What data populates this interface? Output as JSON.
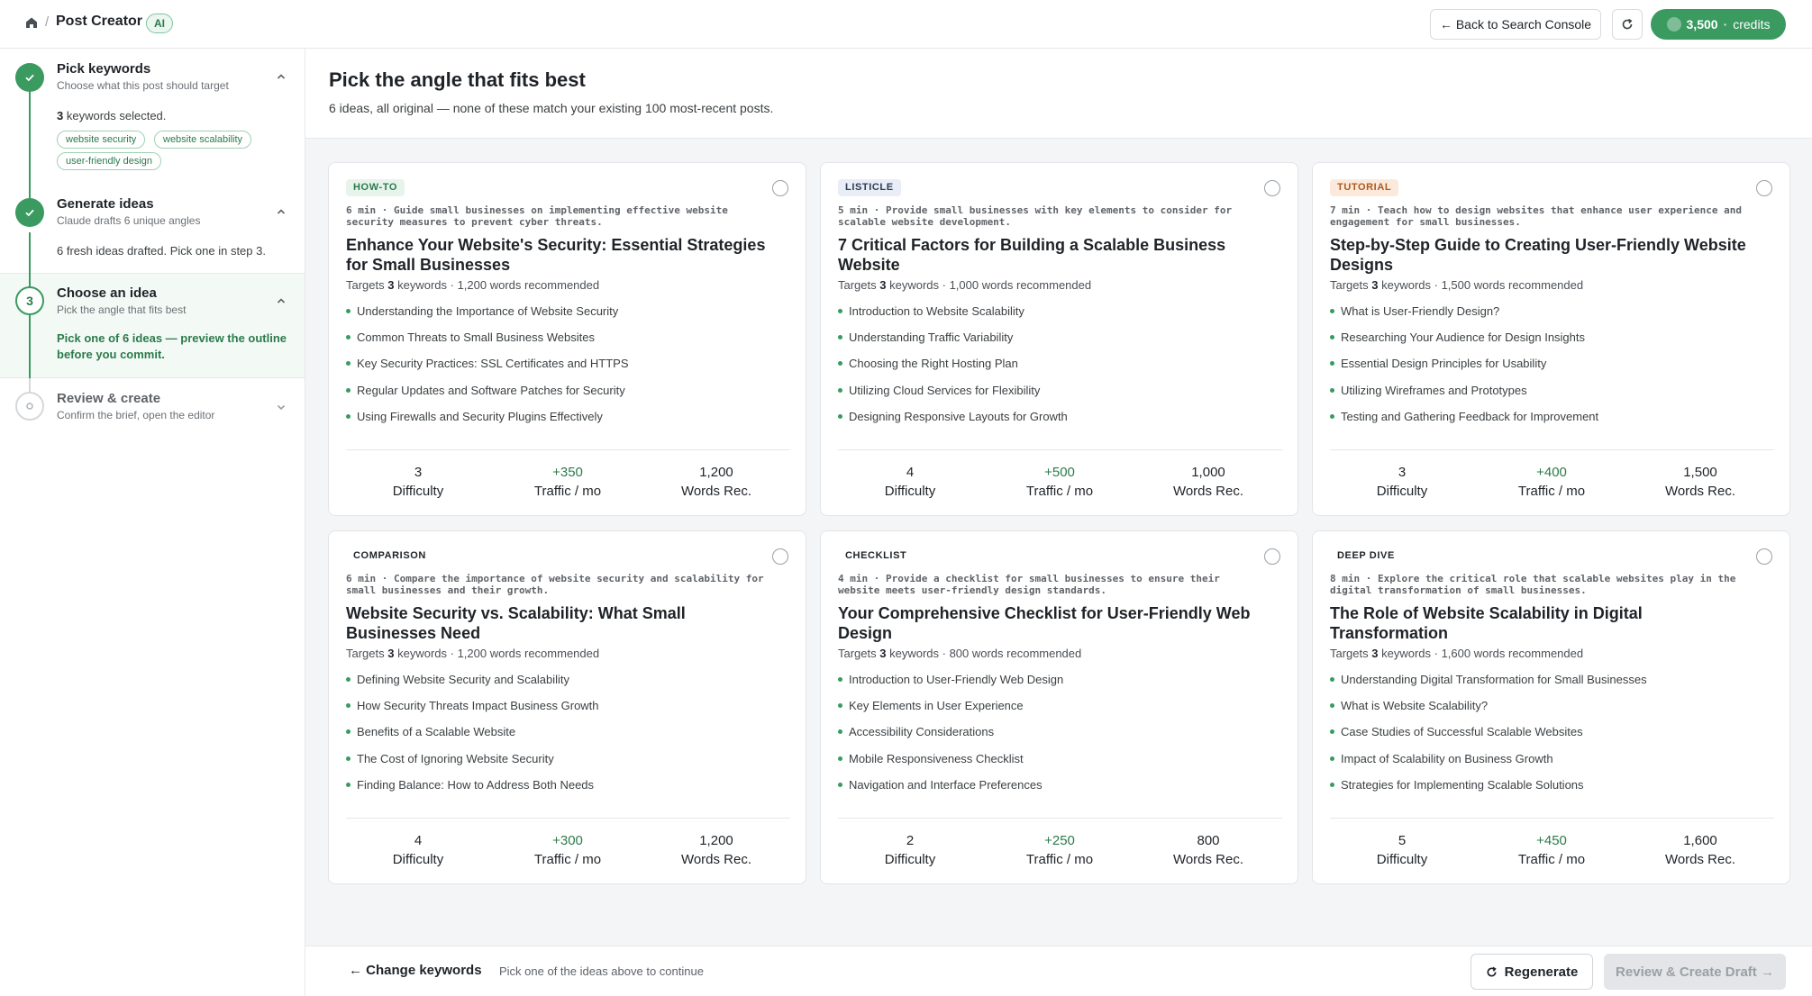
{
  "header": {
    "app_title": "Post Creator",
    "ai_badge": "AI",
    "back_label": "← Back to Search Console",
    "credits_value": "3,500",
    "credits_sep": "·",
    "credits_label": "credits"
  },
  "sidebar": {
    "steps": [
      {
        "title": "Pick keywords",
        "subtitle": "Choose what this post should target",
        "state": "done"
      },
      {
        "title": "Generate ideas",
        "subtitle": "Claude drafts 6 unique angles",
        "state": "done"
      },
      {
        "number": "3",
        "title": "Choose an idea",
        "subtitle": "Pick the angle that fits best",
        "state": "active"
      },
      {
        "title": "Review & create",
        "subtitle": "Confirm the brief, open the editor",
        "state": "pending"
      }
    ],
    "keywords_count": "3",
    "keywords_suffix": " keywords selected.",
    "keyword_chips": [
      "website security",
      "website scalability",
      "user-friendly design"
    ],
    "generate_note": "6 fresh ideas drafted. Pick one in step 3.",
    "choose_note": "Pick one of 6 ideas — preview the outline before you commit."
  },
  "main": {
    "title": "Pick the angle that fits best",
    "subtitle": "6 ideas, all original — none of these match your existing 100 most-recent posts.",
    "targets_prefix": "Targets ",
    "targets_mid": " keywords · ",
    "stat_labels": {
      "difficulty": "Difficulty",
      "traffic": "Traffic / mo",
      "words": "Words Rec."
    },
    "cards": [
      {
        "badge": "HOW-TO",
        "meta": "6 min · Guide small businesses on implementing effective website security measures to prevent cyber threats.",
        "title": "Enhance Your Website's Security: Essential Strategies for Small Businesses",
        "keywords": "3",
        "words_text": "1,200 words recommended",
        "outline": [
          "Understanding the Importance of Website Security",
          "Common Threats to Small Business Websites",
          "Key Security Practices: SSL Certificates and HTTPS",
          "Regular Updates and Software Patches for Security",
          "Using Firewalls and Security Plugins Effectively"
        ],
        "difficulty": "3",
        "traffic": "+350",
        "words": "1,200"
      },
      {
        "badge": "LISTICLE",
        "meta": "5 min · Provide small businesses with key elements to consider for scalable website development.",
        "title": "7 Critical Factors for Building a Scalable Business Website",
        "keywords": "3",
        "words_text": "1,000 words recommended",
        "outline": [
          "Introduction to Website Scalability",
          "Understanding Traffic Variability",
          "Choosing the Right Hosting Plan",
          "Utilizing Cloud Services for Flexibility",
          "Designing Responsive Layouts for Growth"
        ],
        "difficulty": "4",
        "traffic": "+500",
        "words": "1,000"
      },
      {
        "badge": "TUTORIAL",
        "meta": "7 min · Teach how to design websites that enhance user experience and engagement for small businesses.",
        "title": "Step-by-Step Guide to Creating User-Friendly Website Designs",
        "keywords": "3",
        "words_text": "1,500 words recommended",
        "outline": [
          "What is User-Friendly Design?",
          "Researching Your Audience for Design Insights",
          "Essential Design Principles for Usability",
          "Utilizing Wireframes and Prototypes",
          "Testing and Gathering Feedback for Improvement"
        ],
        "difficulty": "3",
        "traffic": "+400",
        "words": "1,500"
      },
      {
        "badge": "COMPARISON",
        "meta": "6 min · Compare the importance of website security and scalability for small businesses and their growth.",
        "title": "Website Security vs. Scalability: What Small Businesses Need",
        "keywords": "3",
        "words_text": "1,200 words recommended",
        "outline": [
          "Defining Website Security and Scalability",
          "How Security Threats Impact Business Growth",
          "Benefits of a Scalable Website",
          "The Cost of Ignoring Website Security",
          "Finding Balance: How to Address Both Needs"
        ],
        "difficulty": "4",
        "traffic": "+300",
        "words": "1,200"
      },
      {
        "badge": "CHECKLIST",
        "meta": "4 min · Provide a checklist for small businesses to ensure their website meets user-friendly design standards.",
        "title": "Your Comprehensive Checklist for User-Friendly Web Design",
        "keywords": "3",
        "words_text": "800 words recommended",
        "outline": [
          "Introduction to User-Friendly Web Design",
          "Key Elements in User Experience",
          "Accessibility Considerations",
          "Mobile Responsiveness Checklist",
          "Navigation and Interface Preferences"
        ],
        "difficulty": "2",
        "traffic": "+250",
        "words": "800"
      },
      {
        "badge": "DEEP DIVE",
        "meta": "8 min · Explore the critical role that scalable websites play in the digital transformation of small businesses.",
        "title": "The Role of Website Scalability in Digital Transformation",
        "keywords": "3",
        "words_text": "1,600 words recommended",
        "outline": [
          "Understanding Digital Transformation for Small Businesses",
          "What is Website Scalability?",
          "Case Studies of Successful Scalable Websites",
          "Impact of Scalability on Business Growth",
          "Strategies for Implementing Scalable Solutions"
        ],
        "difficulty": "5",
        "traffic": "+450",
        "words": "1,600"
      }
    ]
  },
  "footer": {
    "change_keywords": "Change keywords",
    "hint": "Pick one of the ideas above to continue",
    "regenerate": "Regenerate",
    "review_create": "Review & Create Draft →"
  },
  "colors": {
    "accent": "#3a9a60",
    "accent_dark": "#2c7a4b",
    "badge_howto": "#e6f4ec",
    "badge_listicle": "#e8edf6",
    "badge_tutorial": "#fbeadb"
  }
}
